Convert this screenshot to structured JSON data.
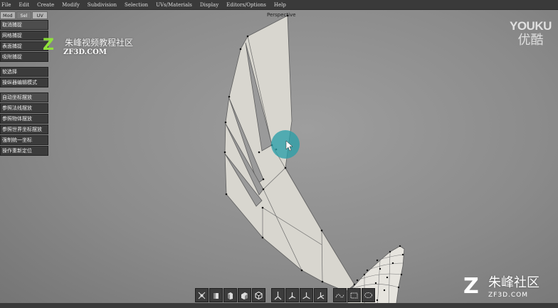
{
  "menu": [
    "File",
    "Edit",
    "Create",
    "Modify",
    "Subdivision",
    "Selection",
    "UVs/Materials",
    "Display",
    "Editors/Options",
    "Help"
  ],
  "viewport": {
    "label": "Perspective"
  },
  "panel": {
    "tabs": [
      "Mod",
      "Sel",
      "UV"
    ],
    "group1": [
      "取消捕捉",
      "网格捕捉",
      "表面捕捉",
      "吸附捕捉"
    ],
    "group2": [
      "软选择",
      "操纵器编辑模式"
    ],
    "group3": [
      "自动坐标摆放",
      "参照法线摆放",
      "参照物体摆放",
      "参照世界坐标摆放",
      "强制统一坐标",
      "操作重新定位"
    ]
  },
  "watermarks": {
    "left": {
      "icon": "z-logo-icon",
      "cn": "朱峰视频教程社区",
      "en": "ZF3D.COM"
    },
    "youku": {
      "en": "YOUKU",
      "cn": "优酷"
    },
    "bottom_right": {
      "icon": "z-logo-icon",
      "cn": "朱峰社区",
      "en": "ZF3D.COM"
    }
  },
  "shelf": {
    "icons": [
      "pivot-tool-icon",
      "cube-front-icon",
      "cube-side-icon",
      "cube-top-icon",
      "cube-perspective-icon",
      "axis-y-icon",
      "axis-rotate-icon",
      "axis-xyz-icon",
      "axis-all-icon",
      "curve-select-icon",
      "marquee-select-icon",
      "lasso-select-icon"
    ]
  },
  "colors": {
    "menu_bg": "#3a3a3a",
    "panel_button": "#3b3b3b",
    "viewport_bg": "#8b8b8b",
    "mesh_fill": "#d8d6cf",
    "cursor_highlight": "#2a9fa8",
    "watermark_green": "#8fe23b"
  }
}
